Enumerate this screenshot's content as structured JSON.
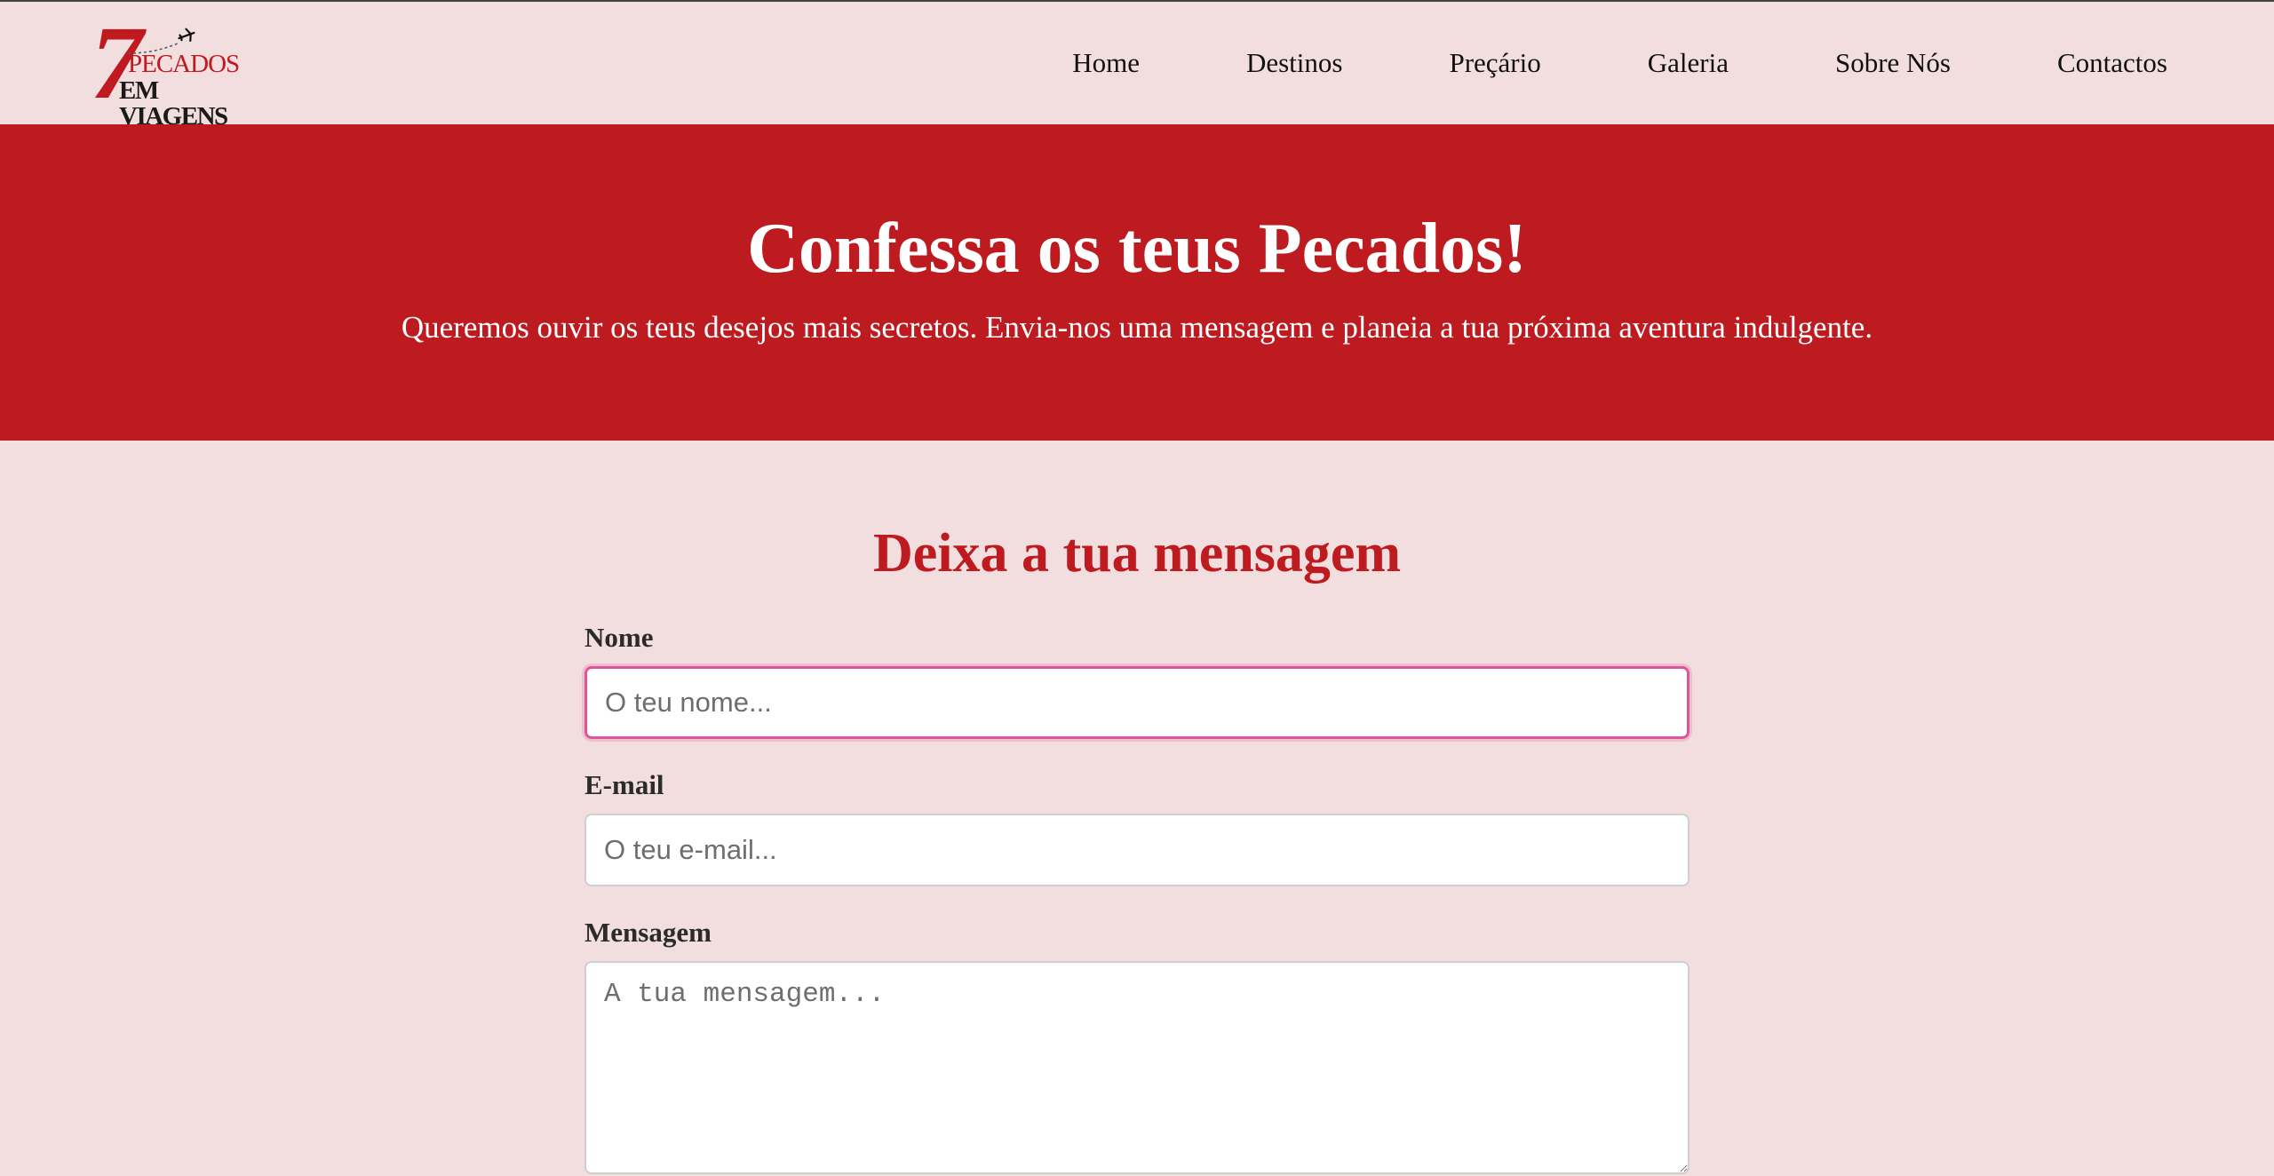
{
  "brand": {
    "logo_number": "7",
    "logo_line1": "PECADOS",
    "logo_line2": "EM VIAGENS",
    "primary_color": "#be1b21",
    "background_color": "#f2dede"
  },
  "nav": {
    "items": [
      {
        "label": "Home"
      },
      {
        "label": "Destinos"
      },
      {
        "label": "Preçário"
      },
      {
        "label": "Galeria"
      },
      {
        "label": "Sobre Nós"
      },
      {
        "label": "Contactos"
      }
    ]
  },
  "hero": {
    "title": "Confessa os teus Pecados!",
    "subtitle": "Queremos ouvir os teus desejos mais secretos. Envia-nos uma mensagem e planeia a tua próxima aventura indulgente."
  },
  "form": {
    "title": "Deixa a tua mensagem",
    "name": {
      "label": "Nome",
      "placeholder": "O teu nome...",
      "value": ""
    },
    "email": {
      "label": "E-mail",
      "placeholder": "O teu e-mail...",
      "value": ""
    },
    "message": {
      "label": "Mensagem",
      "placeholder": "A tua mensagem...",
      "value": ""
    }
  }
}
